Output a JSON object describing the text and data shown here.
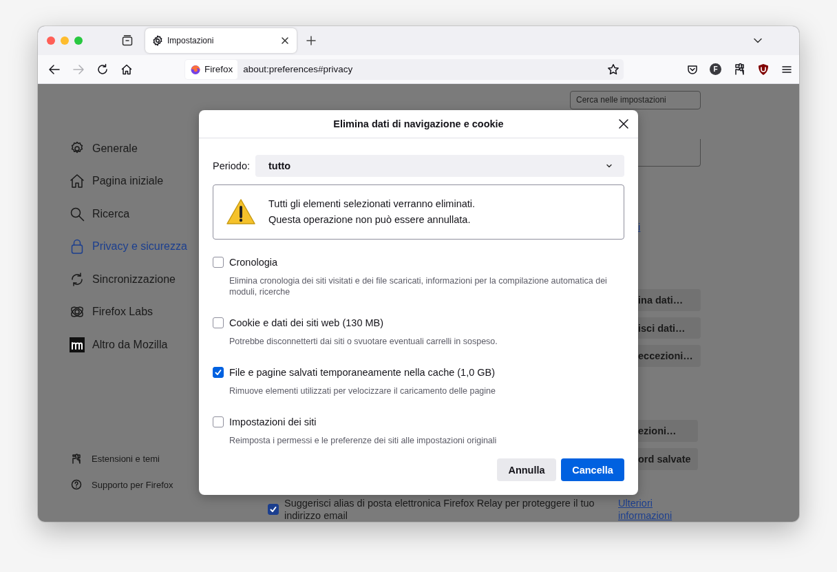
{
  "browser": {
    "tabs": [
      {
        "title": "Impostazioni",
        "selected": true
      }
    ],
    "identity_label": "Firefox",
    "url": "about:preferences#privacy",
    "account_initial": "F"
  },
  "sidebar": {
    "items": [
      {
        "label": "Generale",
        "selected": false
      },
      {
        "label": "Pagina iniziale",
        "selected": false
      },
      {
        "label": "Ricerca",
        "selected": false
      },
      {
        "label": "Privacy e sicurezza",
        "selected": true
      },
      {
        "label": "Sincronizzazione",
        "selected": false
      },
      {
        "label": "Firefox Labs",
        "selected": false
      },
      {
        "label": "Altro da Mozilla",
        "selected": false
      }
    ],
    "footer": [
      {
        "label": "Estensioni e temi"
      },
      {
        "label": "Supporto per Firefox"
      }
    ]
  },
  "settings": {
    "search": {
      "placeholder": "Cerca nelle impostazioni"
    },
    "link_fragment": "i",
    "buttons": [
      "ina dati…",
      "isci dati…",
      "eccezioni…",
      "ezioni…",
      "ord salvate"
    ],
    "relay": {
      "checked": true,
      "text": "Suggerisci alias di posta elettronica Firefox Relay per proteggere il tuo indirizzo email",
      "link": "Ulteriori informazioni"
    }
  },
  "dialog": {
    "title": "Elimina dati di navigazione e cookie",
    "period": {
      "label": "Periodo:",
      "value": "tutto"
    },
    "warning": [
      "Tutti gli elementi selezionati verranno eliminati.",
      "Questa operazione non può essere annullata."
    ],
    "options": [
      {
        "label": "Cronologia",
        "description": "Elimina cronologia dei siti visitati e dei file scaricati, informazioni per la compilazione automatica dei moduli, ricerche",
        "checked": false
      },
      {
        "label": "Cookie e dati dei siti web (130 MB)",
        "description": "Potrebbe disconnetterti dai siti o svuotare eventuali carrelli in sospeso.",
        "checked": false
      },
      {
        "label": "File e pagine salvati temporaneamente nella cache (1,0 GB)",
        "description": "Rimuove elementi utilizzati per velocizzare il caricamento delle pagine",
        "checked": true
      },
      {
        "label": "Impostazioni dei siti",
        "description": "Reimposta i permessi e le preferenze dei siti alle impostazioni originali",
        "checked": false
      }
    ],
    "buttons": [
      {
        "label": "Annulla",
        "kind": "secondary"
      },
      {
        "label": "Cancella",
        "kind": "primary"
      }
    ]
  }
}
